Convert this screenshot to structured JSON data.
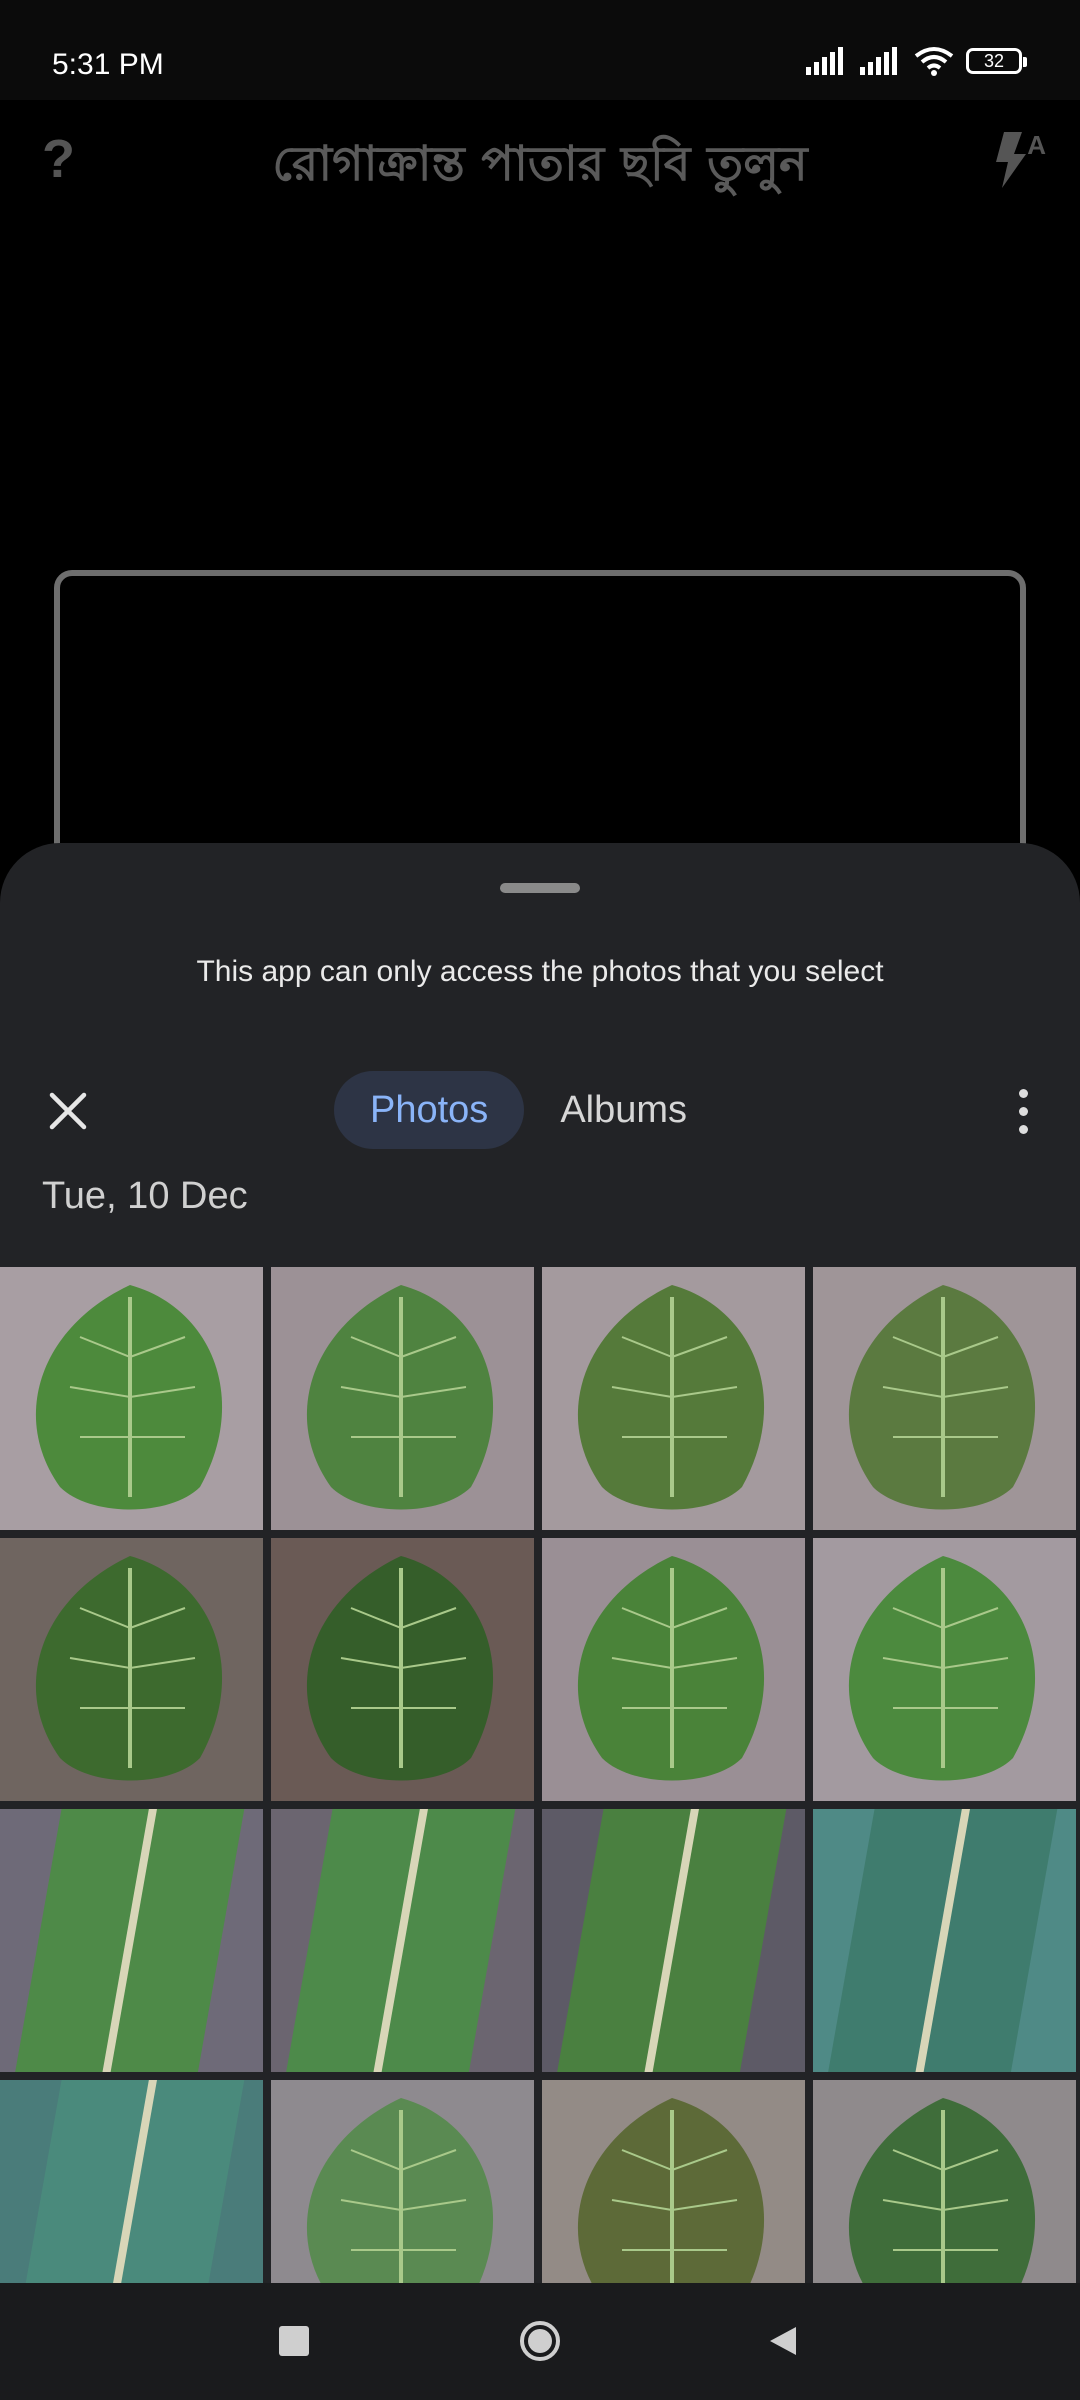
{
  "status": {
    "time": "5:31 PM",
    "battery": "32"
  },
  "camera": {
    "help_label": "?",
    "title": "রোগাক্রান্ত পাতার ছবি তুলুন",
    "flash_mode": "A"
  },
  "picker": {
    "notice": "This app can only access the photos that you select",
    "tabs": [
      {
        "label": "Photos",
        "active": true
      },
      {
        "label": "Albums",
        "active": false
      }
    ],
    "date_header": "Tue, 10 Dec",
    "photos": [
      "potato-leaf-healthy",
      "potato-leaf-lesion",
      "potato-leaf-blight",
      "potato-leaf-blight-severe",
      "tomato-leaf-curl",
      "tomato-leaf-curl-dark",
      "potato-leaf-healthy-2",
      "potato-leaf-healthy-3",
      "maize-leaf-blight",
      "maize-leaf-blight-2",
      "maize-leaf-lesion",
      "maize-leaf-healthy",
      "maize-leaf-closeup",
      "tomato-leaf-healthy",
      "tomato-leaf-late-blight",
      "tomato-leaf-spot"
    ]
  },
  "colors": {
    "accent": "#8ab4f8",
    "sheet": "#222326",
    "leaf": "#3f7d3a"
  }
}
